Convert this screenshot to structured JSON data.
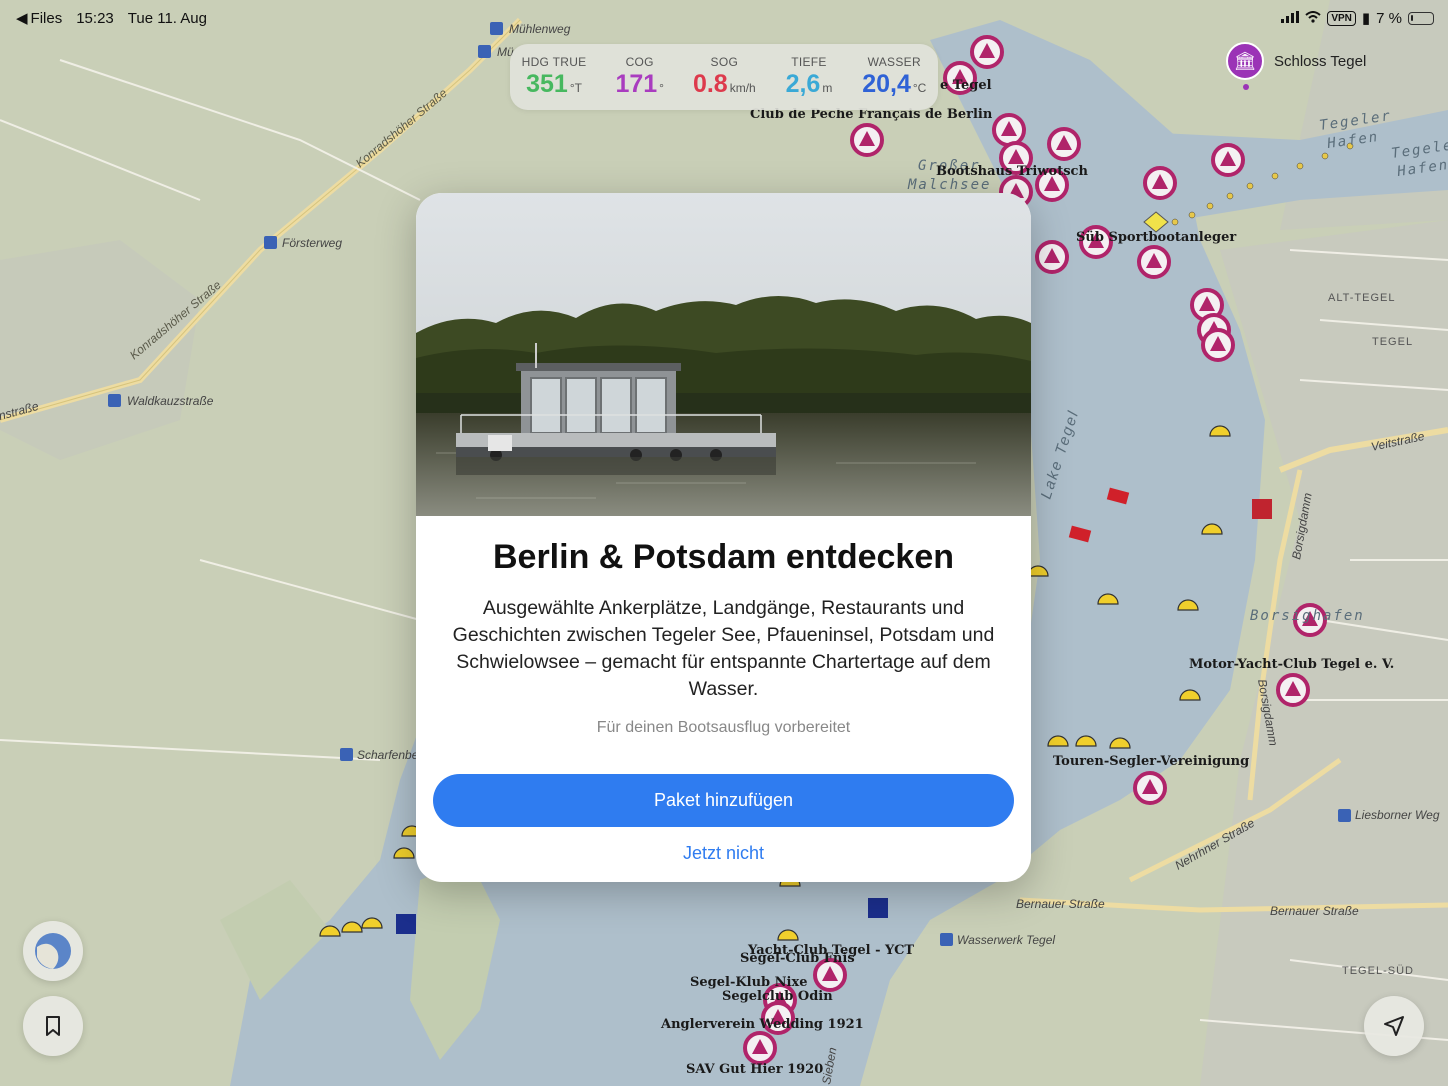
{
  "status_bar": {
    "back_app": "Files",
    "time": "15:23",
    "date": "Tue 11. Aug",
    "vpn": "VPN",
    "battery": "7 %"
  },
  "instruments": [
    {
      "label": "HDG TRUE",
      "value": "351",
      "unit": "°T",
      "color": "#47b85f"
    },
    {
      "label": "COG",
      "value": "171",
      "unit": "°",
      "color": "#a93cbf"
    },
    {
      "label": "SOG",
      "value": "0.8",
      "unit": "km/h",
      "color": "#dd3a4c"
    },
    {
      "label": "TIEFE",
      "value": "2,6",
      "unit": "m",
      "color": "#3aa9d6"
    },
    {
      "label": "WASSER",
      "value": "20,4",
      "unit": "°C",
      "color": "#2f62d6"
    }
  ],
  "location": {
    "name": "Schloss Tegel",
    "icon": "museum-icon"
  },
  "map": {
    "labels": {
      "muehlenweg": "Mühlenweg",
      "mu": "Mü",
      "konradshoehe_1": "Konradshöher Straße",
      "konradshoehe_2": "Konradshöher Straße",
      "foersterweg": "Försterweg",
      "waldkauz": "Waldkauzstraße",
      "instrasse": "nstraße",
      "scharfenb": "Scharfenbe",
      "club_peche": "Club de Peche Français de Berlin",
      "tegel_partial": "e Tegel",
      "grosser_malchsee_1": "Großer",
      "grosser_malchsee_2": "Malchsee",
      "bootshaus": "Bootshaus Triwotsch",
      "tegeler_hafen_1": "Tegeler",
      "tegeler_hafen_2": "Hafen",
      "tegeler_hafen_3": "Tegele",
      "tegeler_hafen_4": "Hafen",
      "sportbootanleger": "Süb Sportbootanleger",
      "alt_tegel": "ALT-TEGEL",
      "tegel": "TEGEL",
      "veitstrasse": "Veitstraße",
      "borsigdamm_1": "Borsigdamm",
      "borsigdamm_2": "Borsigdamm",
      "borsighafen": "Borsighafen",
      "motor_yacht": "Motor-Yacht-Club Tegel e. V.",
      "touren_segler": "Touren-Segler-Vereinigung",
      "liesborner": "Liesborner Weg",
      "nehringer": "Nehrhner Straße",
      "bernauer_1": "Bernauer Straße",
      "bernauer_2": "Bernauer Straße",
      "wasserwerk": "Wasserwerk Tegel",
      "tegel_sued": "TEGEL-SÜD",
      "lake_tegel": "Lake Tegel",
      "yacht_club": "Yacht-Club Tegel - YCT",
      "segel_club_fnis": "Segel-Club Fnis",
      "segel_klub": "Segel-Klub Nixe",
      "segelclub_odin": "Segelclub Odin",
      "anglerverein": "Anglerverein Wedding 1921",
      "sav": "SAV Gut Hier 1920",
      "sieben": "Sieben"
    }
  },
  "modal": {
    "title": "Berlin & Potsdam entdecken",
    "description": "Ausgewählte Ankerplätze, Landgänge, Restaurants und Geschichten zwischen Tegeler See, Pfaueninsel, Potsdam und Schwielowsee – gemacht für entspannte Chartertage auf dem Wasser.",
    "note": "Für deinen Bootsausflug vorbereitet",
    "primary_button": "Paket hinzufügen",
    "secondary_button": "Jetzt nicht",
    "image": "houseboat-photo"
  },
  "controls": {
    "layers_icon": "map-layers-icon",
    "bookmark_icon": "bookmark-icon",
    "navigate_icon": "location-arrow-icon"
  }
}
